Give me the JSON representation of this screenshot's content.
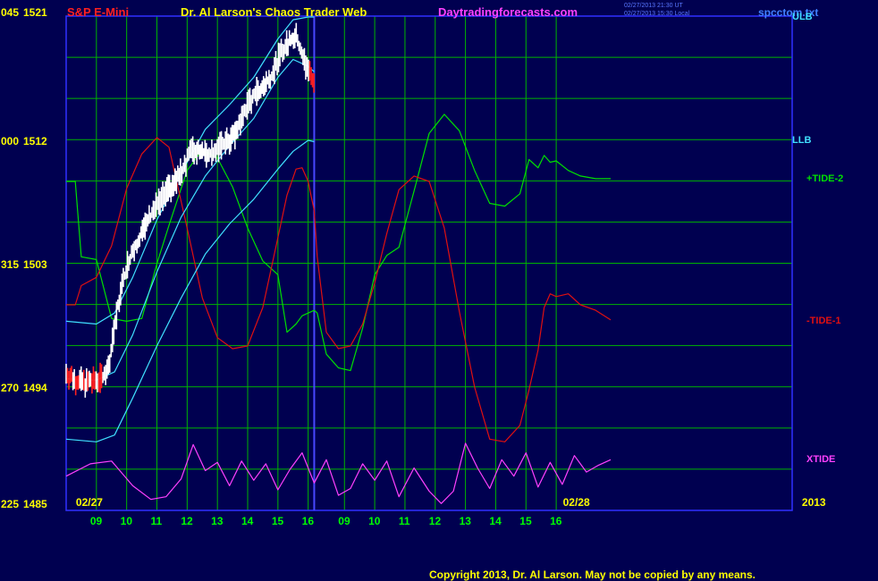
{
  "header": {
    "symbol": "S&P E-Mini",
    "title": "Dr. Al Larson's Chaos Trader Web",
    "site": "Daytradingforecasts.com",
    "stamp1": "02/27/2013 21:30 UT",
    "stamp2": "02/27/2013 15:30 Local",
    "file": "spcctom.txt",
    "copyright": "Copyright 2013, Dr. Al Larson. May not be copied by any means."
  },
  "colors": {
    "background": "#000050",
    "grid": "#00b400",
    "border": "#3030ff",
    "divider": "#4848ff",
    "price": "#ffffff",
    "price_down": "#ff2020",
    "band": "#40e0ff",
    "tide_plus2": "#00e000",
    "tide_minus1": "#e01010",
    "xtide": "#ff40ff",
    "axis_text": "#ffff00",
    "hour_text": "#00ff00"
  },
  "chart_data": {
    "type": "line",
    "x_unit": "hour",
    "x_range": [
      8,
      32.0
    ],
    "y_range": [
      1485,
      1521
    ],
    "y_labels": [
      {
        "left": "045",
        "value": 1521
      },
      {
        "left": "000",
        "value": 1512
      },
      {
        "left": "315",
        "value": 1503
      },
      {
        "left": "270",
        "value": 1494
      },
      {
        "left": "225",
        "value": 1485
      }
    ],
    "date_labels": [
      {
        "text": "02/27",
        "x": 8.5
      },
      {
        "text": "02/28",
        "x": 24.6
      },
      {
        "text": "2013",
        "x": 32.5
      }
    ],
    "hour_ticks": [
      "09",
      "10",
      "11",
      "12",
      "13",
      "14",
      "15",
      "16",
      "09",
      "10",
      "11",
      "12",
      "13",
      "14",
      "15",
      "16"
    ],
    "divider_x": 16.2,
    "right_labels": [
      {
        "text": "ULB",
        "value": 1521,
        "color": "#40e0ff"
      },
      {
        "text": "LLB",
        "value": 1512,
        "color": "#40e0ff"
      },
      {
        "text": "+TIDE-2",
        "value": 1509.2,
        "color": "#00e000"
      },
      {
        "text": "-TIDE-1",
        "value": 1498.8,
        "color": "#e01010"
      },
      {
        "text": "XTIDE",
        "value": 1488.7,
        "color": "#ff40ff"
      }
    ],
    "price": {
      "x": [
        8.0,
        8.3,
        8.6,
        8.9,
        9.1,
        9.4,
        9.7,
        10.0,
        10.3,
        10.6,
        10.9,
        11.2,
        11.5,
        11.8,
        12.1,
        12.4,
        12.7,
        13.0,
        13.3,
        13.6,
        13.9,
        14.2,
        14.5,
        14.8,
        15.0,
        15.2,
        15.4,
        15.6,
        15.8,
        16.0,
        16.2
      ],
      "y": [
        1495,
        1494.5,
        1494.3,
        1494.4,
        1494.6,
        1495.2,
        1499.8,
        1502.8,
        1504.4,
        1505.6,
        1506.9,
        1507.9,
        1508.7,
        1509.6,
        1511.2,
        1511.3,
        1511.0,
        1511.4,
        1511.8,
        1512.5,
        1514.1,
        1515.3,
        1515.9,
        1516.7,
        1517.9,
        1518.7,
        1519.2,
        1519.5,
        1518.2,
        1517.0,
        1516.4
      ]
    },
    "upper_band": {
      "x": [
        8.0,
        9.0,
        9.6,
        10.2,
        11.0,
        11.8,
        12.6,
        13.4,
        14.2,
        15.0,
        15.5,
        16.0,
        16.2
      ],
      "y": [
        1498.8,
        1498.6,
        1499.4,
        1502.0,
        1506.2,
        1509.6,
        1512.8,
        1514.6,
        1516.6,
        1519.4,
        1520.8,
        1521.0,
        1521.0
      ]
    },
    "mid_band": {
      "x": [
        8.0,
        9.0,
        9.6,
        10.2,
        11.0,
        11.8,
        12.6,
        13.4,
        14.2,
        15.0,
        15.5,
        16.0,
        16.2
      ],
      "y": [
        1494.6,
        1494.5,
        1495.1,
        1497.8,
        1502.4,
        1506.4,
        1509.4,
        1511.6,
        1513.6,
        1516.6,
        1517.9,
        1517.4,
        1517.0
      ]
    },
    "lower_band": {
      "x": [
        8.0,
        9.0,
        9.6,
        10.2,
        11.0,
        11.8,
        12.6,
        13.4,
        14.2,
        15.0,
        15.5,
        16.0,
        16.2
      ],
      "y": [
        1490.2,
        1490.0,
        1490.5,
        1493.2,
        1497.0,
        1500.5,
        1503.7,
        1505.9,
        1507.7,
        1509.9,
        1511.2,
        1512.0,
        1511.9
      ]
    },
    "tide_plus2": {
      "x": [
        8.0,
        8.3,
        8.5,
        9.0,
        9.5,
        10.0,
        10.5,
        11.0,
        11.4,
        12.0,
        12.5,
        13.0,
        13.5,
        14.0,
        14.5,
        15.0,
        15.3,
        15.6,
        15.8,
        16.0,
        16.1,
        16.2,
        16.3,
        16.6,
        17.0,
        17.4,
        17.8,
        18.2,
        18.6,
        19.0,
        19.5,
        20.0,
        20.5,
        21.0,
        21.5,
        22.0,
        22.5,
        23.0,
        23.3,
        23.6,
        23.8,
        24.0,
        24.2,
        24.6,
        25.0,
        25.5,
        26.0
      ],
      "y": [
        1509,
        1509,
        1503.5,
        1503.3,
        1499.0,
        1498.8,
        1499.0,
        1503.0,
        1505.8,
        1509.8,
        1511.3,
        1510.7,
        1508.6,
        1505.6,
        1503.2,
        1502.2,
        1498.0,
        1498.6,
        1499.2,
        1499.4,
        1499.5,
        1499.6,
        1499.4,
        1496.4,
        1495.4,
        1495.2,
        1498.3,
        1502.2,
        1503.6,
        1504.2,
        1508.3,
        1512.5,
        1513.9,
        1512.7,
        1509.8,
        1507.4,
        1507.2,
        1508.1,
        1510.6,
        1510.0,
        1510.9,
        1510.4,
        1510.5,
        1509.8,
        1509.4,
        1509.2,
        1509.2
      ]
    },
    "tide_minus1": {
      "x": [
        8.0,
        8.3,
        8.5,
        9.0,
        9.5,
        10.0,
        10.5,
        11.0,
        11.4,
        12.0,
        12.5,
        13.0,
        13.5,
        14.0,
        14.5,
        15.0,
        15.3,
        15.6,
        15.8,
        16.0,
        16.1,
        16.2,
        16.3,
        16.6,
        17.0,
        17.4,
        17.8,
        18.2,
        18.6,
        19.0,
        19.5,
        20.0,
        20.5,
        21.0,
        21.5,
        22.0,
        22.5,
        23.0,
        23.3,
        23.6,
        23.8,
        24.0,
        24.2,
        24.6,
        25.0,
        25.5,
        26.0
      ],
      "y": [
        1500,
        1500,
        1501.4,
        1502.0,
        1504.3,
        1508.5,
        1511.0,
        1512.2,
        1511.5,
        1505.6,
        1500.5,
        1497.6,
        1496.8,
        1497.0,
        1499.8,
        1504.9,
        1508.0,
        1509.9,
        1510.0,
        1509.0,
        1507.9,
        1506.9,
        1503.5,
        1498.0,
        1496.8,
        1497.0,
        1498.6,
        1501.6,
        1505.2,
        1508.4,
        1509.4,
        1509.0,
        1505.6,
        1499.5,
        1494.0,
        1490.2,
        1490.0,
        1491.2,
        1493.8,
        1496.7,
        1499.8,
        1500.8,
        1500.6,
        1500.8,
        1500.0,
        1499.6,
        1498.9
      ]
    },
    "xtide": {
      "x": [
        8.0,
        8.8,
        9.5,
        10.2,
        10.8,
        11.3,
        11.8,
        12.2,
        12.6,
        13.0,
        13.4,
        13.8,
        14.2,
        14.6,
        15.0,
        15.4,
        15.8,
        16.2,
        16.6,
        17.0,
        17.4,
        17.8,
        18.2,
        18.6,
        19.0,
        19.5,
        20.0,
        20.4,
        20.8,
        21.2,
        21.6,
        22.0,
        22.4,
        22.8,
        23.2,
        23.6,
        24.0,
        24.4,
        24.8,
        25.2,
        25.6,
        26.0
      ],
      "y": [
        1487.5,
        1488.4,
        1488.6,
        1486.8,
        1485.8,
        1486.0,
        1487.3,
        1489.8,
        1487.9,
        1488.5,
        1486.8,
        1488.6,
        1487.2,
        1488.4,
        1486.5,
        1488.0,
        1489.2,
        1487.0,
        1488.7,
        1486.1,
        1486.6,
        1488.4,
        1487.2,
        1488.6,
        1486.0,
        1488.1,
        1486.4,
        1485.5,
        1486.4,
        1489.9,
        1488.1,
        1486.6,
        1488.7,
        1487.5,
        1489.2,
        1486.7,
        1488.5,
        1486.9,
        1489.0,
        1487.8,
        1488.3,
        1488.7
      ]
    }
  }
}
